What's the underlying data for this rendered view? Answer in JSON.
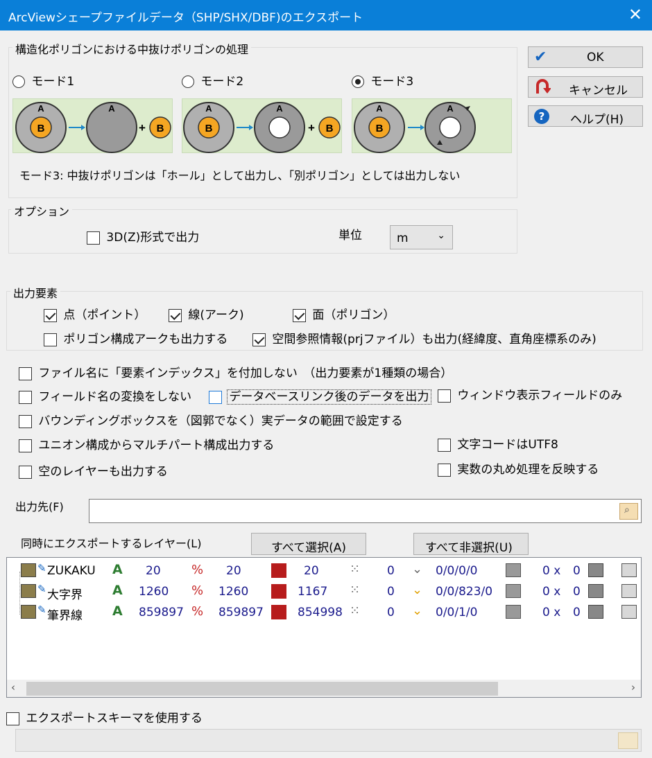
{
  "window": {
    "title": "ArcViewシェープファイルデータ（SHP/SHX/DBF)のエクスポート",
    "close_label": "✕"
  },
  "buttons": {
    "ok": "OK",
    "cancel": "キャンセル",
    "help": "ヘルプ(H)",
    "select_all": "すべて選択(A)",
    "deselect_all": "すべて非選択(U)"
  },
  "polygon_group": {
    "legend": "構造化ポリゴンにおける中抜けポリゴンの処理",
    "modes": [
      {
        "label": "モード1",
        "selected": false
      },
      {
        "label": "モード2",
        "selected": false
      },
      {
        "label": "モード3",
        "selected": true
      }
    ],
    "diagram_letters": {
      "a": "A",
      "b": "B",
      "plus": "+"
    },
    "description": "モード3: 中抜けポリゴンは「ホール」として出力し、「別ポリゴン」としては出力しない"
  },
  "options_group": {
    "legend": "オプション",
    "output_3d": {
      "label": "3D(Z)形式で出力",
      "checked": false
    },
    "unit_label": "単位",
    "unit_value": "m"
  },
  "elements_group": {
    "legend": "出力要素",
    "point": {
      "label": "点（ポイント）",
      "checked": true
    },
    "line": {
      "label": "線(アーク)",
      "checked": true
    },
    "polygon": {
      "label": "面（ポリゴン）",
      "checked": true
    },
    "polygon_arc": {
      "label": "ポリゴン構成アークも出力する",
      "checked": false
    },
    "prj": {
      "label": "空間参照情報(prjファイル）も出力(経緯度、直角座標系のみ)",
      "checked": true
    }
  },
  "misc_options": {
    "no_index_suffix": {
      "label": "ファイル名に「要素インデックス」を付加しない　（出力要素が1種類の場合）",
      "checked": false
    },
    "no_field_convert": {
      "label": "フィールド名の変換をしない",
      "checked": false
    },
    "db_link_data": {
      "label": "データベースリンク後のデータを出力",
      "checked": false
    },
    "window_fields_only": {
      "label": "ウィンドウ表示フィールドのみ",
      "checked": false
    },
    "bbox_actual": {
      "label": "バウンディングボックスを（図郭でなく）実データの範囲で設定する",
      "checked": false
    },
    "union_multipart": {
      "label": "ユニオン構成からマルチパート構成出力する",
      "checked": false
    },
    "utf8": {
      "label": "文字コードはUTF8",
      "checked": false
    },
    "empty_layers": {
      "label": "空のレイヤーも出力する",
      "checked": false
    },
    "rounding": {
      "label": "実数の丸め処理を反映する",
      "checked": false
    }
  },
  "output": {
    "label": "出力先(F)",
    "value": ""
  },
  "layers": {
    "label": "同時にエクスポートするレイヤー(L)",
    "rows": [
      {
        "name": "ZUKAKU",
        "points": "20",
        "arcs": "20",
        "polygons": "20",
        "v1": "0",
        "v2": "0/0/0/0",
        "v3": "0 x",
        "v4": "0"
      },
      {
        "name": "大字界",
        "points": "1260",
        "arcs": "1260",
        "polygons": "1167",
        "v1": "0",
        "v2": "0/0/823/0",
        "v3": "0 x",
        "v4": "0"
      },
      {
        "name": "筆界線",
        "points": "859897",
        "arcs": "859897",
        "polygons": "854998",
        "v1": "0",
        "v2": "0/0/1/0",
        "v3": "0 x",
        "v4": "0"
      }
    ]
  },
  "schema": {
    "label": "エクスポートスキーマを使用する",
    "checked": false,
    "value": ""
  },
  "colors": {
    "title_bar": "#0a7fd8",
    "diagram_bg": "#ddeccd",
    "circle_gray": "#b0b0b0",
    "circle_orange": "#f5a623",
    "number_blue": "#1a1a8c"
  },
  "icons": {
    "ok": "check-icon",
    "cancel": "undo-arrow-icon",
    "help": "question-icon",
    "browse": "folder-browse-icon"
  }
}
